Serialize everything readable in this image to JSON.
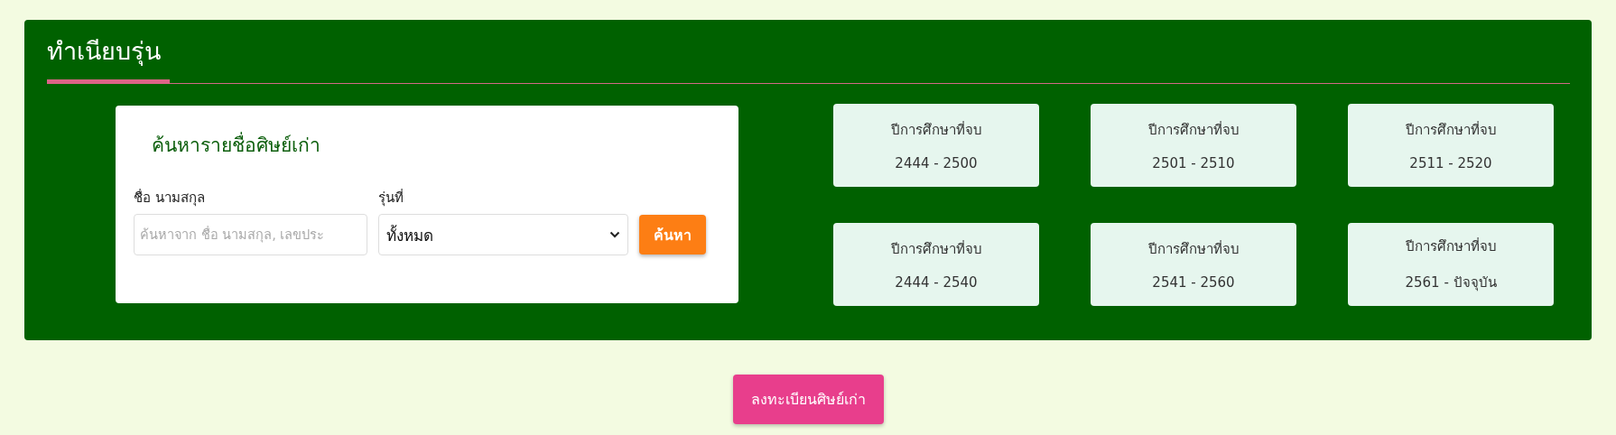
{
  "panel": {
    "title": "ทำเนียบรุ่น"
  },
  "search": {
    "heading": "ค้นหารายชื่อศิษย์เก่า",
    "name_label": "ชื่อ นามสกุล",
    "name_placeholder": "ค้นหาจาก ชื่อ นามสกุล, เลขประ",
    "class_label": "รุ่นที่",
    "class_value": "ทั้งหมด",
    "button": "ค้นหา"
  },
  "year_cards": [
    {
      "label": "ปีการศึกษาที่จบ",
      "range": "2444 - 2500"
    },
    {
      "label": "ปีการศึกษาที่จบ",
      "range": "2501 - 2510"
    },
    {
      "label": "ปีการศึกษาที่จบ",
      "range": "2511 - 2520"
    },
    {
      "label": "ปีการศึกษาที่จบ",
      "range": "2444 - 2540"
    },
    {
      "label": "ปีการศึกษาที่จบ",
      "range": "2541 - 2560"
    },
    {
      "label": "ปีการศึกษาที่จบ",
      "range": "2561 - ปัจจุบัน"
    }
  ],
  "register_button": "ลงทะเบียนศิษย์เก่า"
}
